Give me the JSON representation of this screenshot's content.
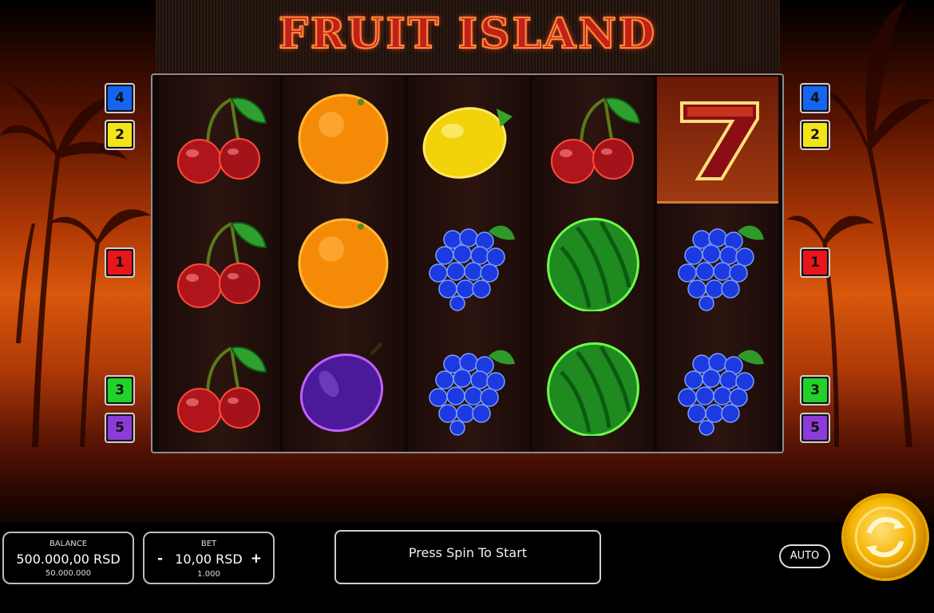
{
  "title": "FRUIT ISLAND",
  "reels": [
    [
      "cherry-icon",
      "cherry-icon",
      "cherry-icon"
    ],
    [
      "orange-icon",
      "orange-icon",
      "plum-icon"
    ],
    [
      "lemon-icon",
      "grapes-icon",
      "grapes-icon"
    ],
    [
      "cherry-icon",
      "watermelon-icon",
      "watermelon-icon"
    ],
    [
      "seven-icon",
      "grapes-icon",
      "grapes-icon"
    ]
  ],
  "paylines": {
    "left": [
      "4",
      "2",
      "1",
      "3",
      "5"
    ],
    "right": [
      "4",
      "2",
      "1",
      "3",
      "5"
    ],
    "colors": {
      "1": "#e8161b",
      "2": "#f3e41a",
      "3": "#22d22a",
      "4": "#1565f0",
      "5": "#8d3bd8"
    }
  },
  "balance": {
    "label": "BALANCE",
    "amount": "500.000,00 RSD",
    "credits": "50.000.000"
  },
  "bet": {
    "label": "BET",
    "minus": "-",
    "amount": "10,00 RSD",
    "plus": "+",
    "credits": "1.000"
  },
  "message": "Press Spin To Start",
  "auto_label": "AUTO",
  "spin_icon": "spin-icon"
}
